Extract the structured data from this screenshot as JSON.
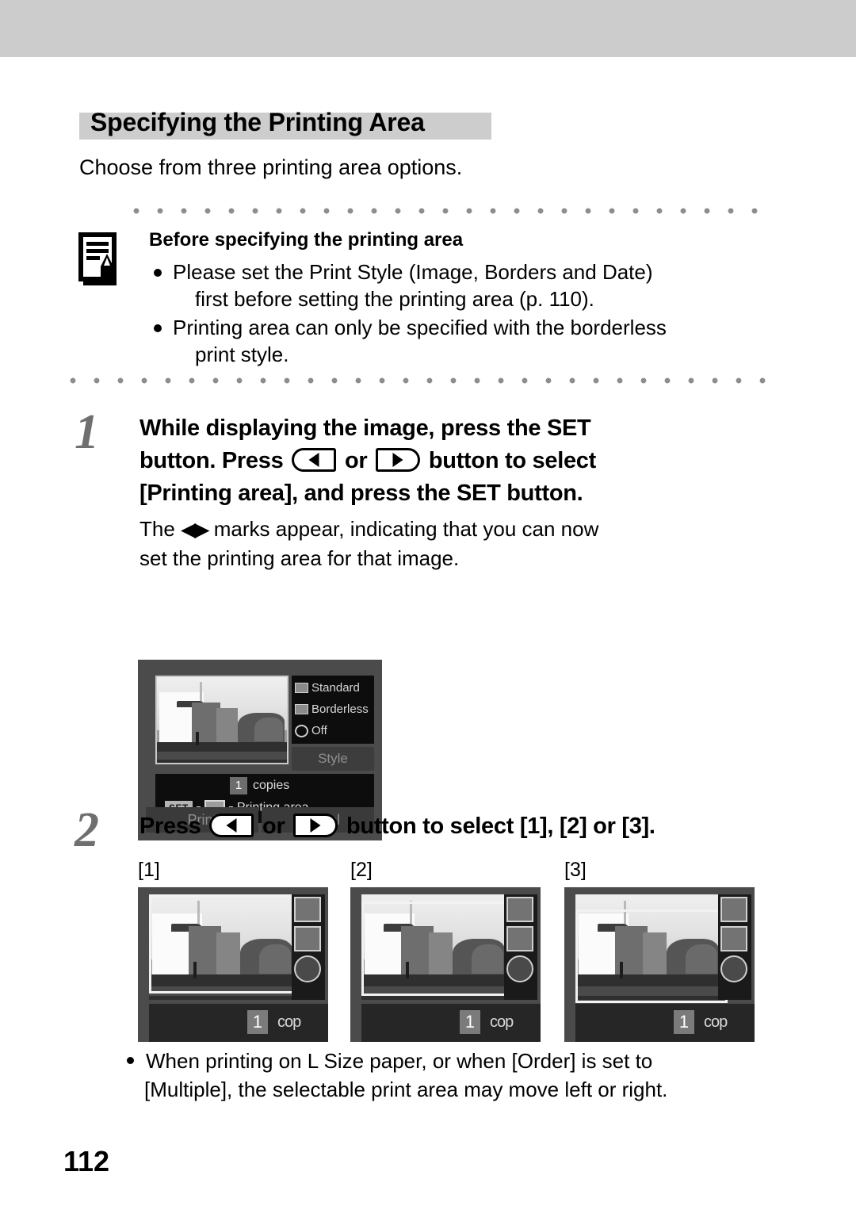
{
  "page": {
    "number": "112",
    "header_band_color": "#cccccc"
  },
  "section": {
    "title": "Specifying the Printing Area",
    "title_band_color": "#cdcdcd",
    "intro": "Choose from three printing area options."
  },
  "note": {
    "icon": "note-pencil-icon",
    "heading": "Before specifying the printing area",
    "items": [
      {
        "line1": "Please set the Print Style (Image, Borders and Date)",
        "line2": "first before setting the printing area (p. 110)."
      },
      {
        "line1": "Printing area can only be specified with the borderless",
        "line2": "print style."
      }
    ]
  },
  "steps": [
    {
      "number": "1",
      "head_part1": "While displaying the image, press the SET",
      "head_part2": "button. Press",
      "head_or": "or",
      "head_part3": "button to select",
      "head_part4": "[Printing area], and press the SET button.",
      "sub_the": "The",
      "sub_marks": "◀▶",
      "sub_part1": "marks appear, indicating that you can now",
      "sub_part2": "set the printing area for that image."
    },
    {
      "number": "2",
      "head_part1": "Press",
      "head_or": "or",
      "head_part2": "button to select [1], [2] or [3]."
    }
  ],
  "lcd_screen": {
    "option_standard": "Standard",
    "option_borderless": "Borderless",
    "option_off": "Off",
    "style_label": "Style",
    "copies_count": "1",
    "copies_label": "copies",
    "set_key": "SET",
    "printing_area_label": "Printing area",
    "print_button": "Print",
    "cancel_button": "Cancel"
  },
  "crop_examples": {
    "labels": [
      "[1]",
      "[2]",
      "[3]"
    ],
    "copies_count": "1",
    "copies_label": "cop"
  },
  "bottom_note": {
    "line1": "When printing on L Size paper, or when [Order] is set to",
    "line2": "[Multiple], the selectable print area may move left or right."
  }
}
